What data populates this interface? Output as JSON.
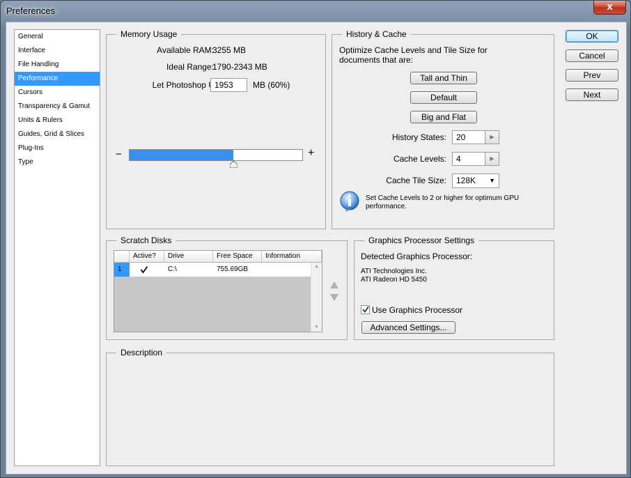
{
  "window": {
    "title": "Preferences",
    "close_label": "x"
  },
  "sidebar": {
    "items": [
      {
        "label": "General"
      },
      {
        "label": "Interface"
      },
      {
        "label": "File Handling"
      },
      {
        "label": "Performance"
      },
      {
        "label": "Cursors"
      },
      {
        "label": "Transparency & Gamut"
      },
      {
        "label": "Units & Rulers"
      },
      {
        "label": "Guides, Grid & Slices"
      },
      {
        "label": "Plug-Ins"
      },
      {
        "label": "Type"
      }
    ],
    "selected_index": 3
  },
  "memory": {
    "title": "Memory Usage",
    "available_label": "Available RAM:",
    "available_value": "3255 MB",
    "ideal_label": "Ideal Range:",
    "ideal_value": "1790-2343 MB",
    "use_label": "Let Photoshop Use:",
    "use_value": "1953",
    "use_unit": "MB (60%)",
    "slider_fraction": 0.6,
    "minus": "−",
    "plus": "+"
  },
  "history": {
    "title": "History & Cache",
    "description": "Optimize Cache Levels and Tile Size for documents that are:",
    "buttons": [
      "Tall and Thin",
      "Default",
      "Big and Flat"
    ],
    "history_states_label": "History States:",
    "history_states_value": "20",
    "cache_levels_label": "Cache Levels:",
    "cache_levels_value": "4",
    "tile_size_label": "Cache Tile Size:",
    "tile_size_value": "128K",
    "info_text": "Set Cache Levels to 2 or higher for optimum GPU performance."
  },
  "scratch": {
    "title": "Scratch Disks",
    "columns": [
      "Active?",
      "Drive",
      "Free Space",
      "Information"
    ],
    "rows": [
      {
        "num": "1",
        "active": true,
        "drive": "C:\\",
        "free": "755.69GB",
        "info": ""
      }
    ]
  },
  "gpu": {
    "title": "Graphics Processor Settings",
    "detected_label": "Detected Graphics Processor:",
    "vendor": "ATI Technologies Inc.",
    "model": "ATI Radeon HD 5450",
    "use_label": "Use Graphics Processor",
    "use_checked": true,
    "advanced_label": "Advanced Settings..."
  },
  "description": {
    "title": "Description"
  },
  "actions": {
    "ok": "OK",
    "cancel": "Cancel",
    "prev": "Prev",
    "next": "Next"
  },
  "colors": {
    "selection": "#3399ff",
    "slider": "#3b8fee",
    "close": "#c94c36"
  }
}
